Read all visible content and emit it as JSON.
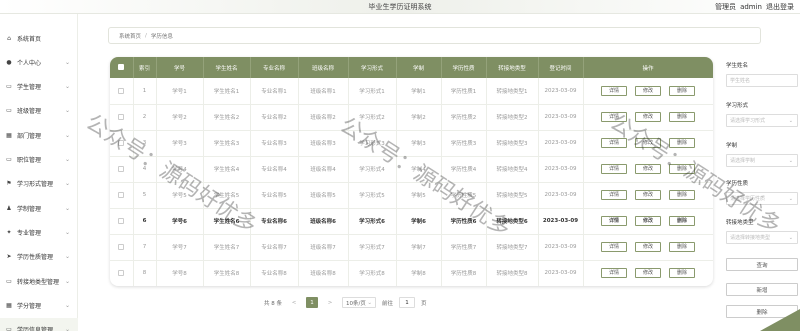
{
  "header": {
    "title": "毕业生学历证明系统",
    "role_label": "管理员",
    "username": "admin",
    "logout_label": "退出登录"
  },
  "sidebar": {
    "items": [
      {
        "label": "系统首页",
        "icon": "home-icon",
        "glyph": "⌂",
        "has_arrow": false
      },
      {
        "label": "个人中心",
        "icon": "user-icon",
        "glyph": "●",
        "has_arrow": true
      },
      {
        "label": "学生管理",
        "icon": "monitor-icon",
        "glyph": "▭",
        "has_arrow": true
      },
      {
        "label": "班级管理",
        "icon": "monitor-icon",
        "glyph": "▭",
        "has_arrow": true
      },
      {
        "label": "部门管理",
        "icon": "grid-icon",
        "glyph": "▦",
        "has_arrow": true
      },
      {
        "label": "职位管理",
        "icon": "monitor-icon",
        "glyph": "▭",
        "has_arrow": true
      },
      {
        "label": "学习形式管理",
        "icon": "flag-icon",
        "glyph": "⚑",
        "has_arrow": true
      },
      {
        "label": "学制管理",
        "icon": "person-icon",
        "glyph": "♟",
        "has_arrow": true
      },
      {
        "label": "专业管理",
        "icon": "star-icon",
        "glyph": "✦",
        "has_arrow": true
      },
      {
        "label": "学历性质管理",
        "icon": "send-icon",
        "glyph": "➤",
        "has_arrow": true
      },
      {
        "label": "转接地类型管理",
        "icon": "monitor-icon",
        "glyph": "▭",
        "has_arrow": true
      },
      {
        "label": "学分管理",
        "icon": "grid-icon",
        "glyph": "▦",
        "has_arrow": true
      },
      {
        "label": "学历信息管理",
        "icon": "monitor-icon",
        "glyph": "▭",
        "has_arrow": true
      }
    ]
  },
  "breadcrumb": {
    "home": "系统首页",
    "separator": "/",
    "current": "学历信息"
  },
  "table": {
    "columns": [
      "索引",
      "学号",
      "学生姓名",
      "专业名称",
      "班级名称",
      "学习形式",
      "学制",
      "学历性质",
      "转接地类型",
      "登记时间",
      "操作"
    ],
    "actions": [
      "详情",
      "修改",
      "删除"
    ],
    "rows": [
      [
        "1",
        "学号1",
        "学生姓名1",
        "专业名称1",
        "班级名称1",
        "学习形式1",
        "学制1",
        "学历性质1",
        "转接地类型1",
        "2023-03-09"
      ],
      [
        "2",
        "学号2",
        "学生姓名2",
        "专业名称2",
        "班级名称2",
        "学习形式2",
        "学制2",
        "学历性质2",
        "转接地类型2",
        "2023-03-09"
      ],
      [
        "3",
        "学号3",
        "学生姓名3",
        "专业名称3",
        "班级名称3",
        "学习形式3",
        "学制3",
        "学历性质3",
        "转接地类型3",
        "2023-03-09"
      ],
      [
        "4",
        "学号4",
        "学生姓名4",
        "专业名称4",
        "班级名称4",
        "学习形式4",
        "学制4",
        "学历性质4",
        "转接地类型4",
        "2023-03-09"
      ],
      [
        "5",
        "学号5",
        "学生姓名5",
        "专业名称5",
        "班级名称5",
        "学习形式5",
        "学制5",
        "学历性质5",
        "转接地类型5",
        "2023-03-09"
      ],
      [
        "6",
        "学号6",
        "学生姓名6",
        "专业名称6",
        "班级名称6",
        "学习形式6",
        "学制6",
        "学历性质6",
        "转接地类型6",
        "2023-03-09"
      ],
      [
        "7",
        "学号7",
        "学生姓名7",
        "专业名称7",
        "班级名称7",
        "学习形式7",
        "学制7",
        "学历性质7",
        "转接地类型7",
        "2023-03-09"
      ],
      [
        "8",
        "学号8",
        "学生姓名8",
        "专业名称8",
        "班级名称8",
        "学习形式8",
        "学制8",
        "学历性质8",
        "转接地类型8",
        "2023-03-09"
      ]
    ],
    "highlight_row": 6
  },
  "pagination": {
    "total_text": "共 8 条",
    "prev": "<",
    "current_page": "1",
    "next": ">",
    "page_size": "10条/页",
    "goto_label": "前往",
    "goto_value": "1",
    "page_unit": "页"
  },
  "search": {
    "fields": [
      {
        "label": "学生姓名",
        "placeholder": "学生姓名",
        "type": "text"
      },
      {
        "label": "学习形式",
        "placeholder": "请选择学习形式",
        "type": "select"
      },
      {
        "label": "学制",
        "placeholder": "请选择学制",
        "type": "select"
      },
      {
        "label": "学历性质",
        "placeholder": "请选择学历性质",
        "type": "select"
      },
      {
        "label": "转接地类型",
        "placeholder": "请选择转接地类型",
        "type": "select"
      }
    ],
    "query_label": "查询",
    "add_label": "新增",
    "delete_label": "删除"
  },
  "watermark": {
    "text": "公众号：源码好优多"
  },
  "colors": {
    "accent": "#7f8f63",
    "header_text": "#ffffff"
  }
}
